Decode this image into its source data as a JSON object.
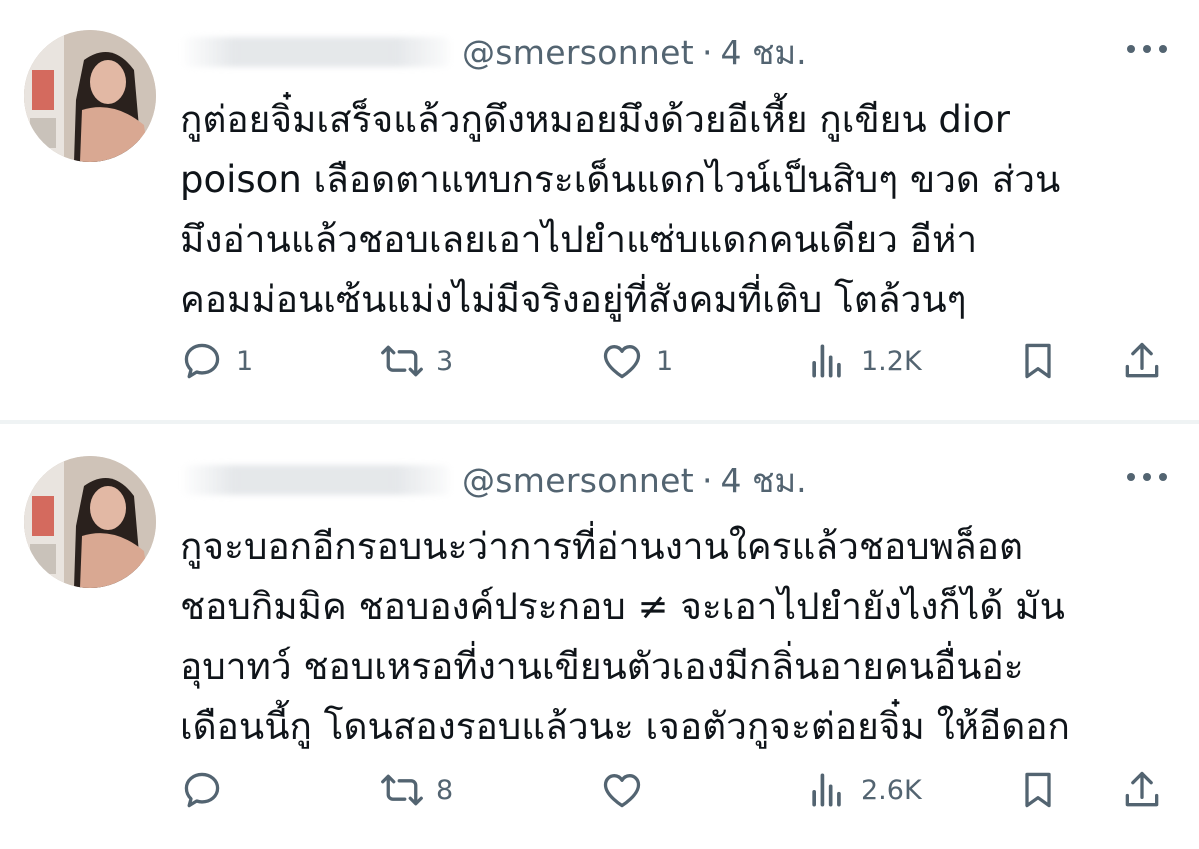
{
  "tweets": [
    {
      "handle": "@smersonnet",
      "separator": "·",
      "time": "4 ชม.",
      "text": "กูต่อยจิ๋มเสร็จแล้วกูดึงหมอยมึงด้วยอีเหี้ย กูเขียน dior\npoison เลือดตาแทบกระเด็นแดกไวน์เป็นสิบๆ ขวด ส่วน\nมึงอ่านแล้วชอบเลยเอาไปยำแซ่บแดกคนเดียว อีห่า\nคอมม่อนเซ้นแม่งไม่มีจริงอยู่ที่สังคมที่เติบ โตล้วนๆ",
      "replies": "1",
      "retweets": "3",
      "likes": "1",
      "views": "1.2K"
    },
    {
      "handle": "@smersonnet",
      "separator": "·",
      "time": "4 ชม.",
      "text": "กูจะบอกอีกรอบนะว่าการที่อ่านงานใครแล้วชอบพล็อต\nชอบกิมมิค ชอบองค์ประกอบ ≠ จะเอาไปยำยังไงก็ได้ มัน\nอุบาทว์ ชอบเหรอที่งานเขียนตัวเองมีกลิ่นอายคนอื่นอ่ะ\nเดือนนี้กู โดนสองรอบแล้วนะ เจอตัวกูจะต่อยจิ๋ม ให้อีดอก",
      "replies": "",
      "retweets": "8",
      "likes": "",
      "views": "2.6K"
    }
  ],
  "colors": {
    "text": "#0f1419",
    "secondary": "#536471",
    "divider": "#eff3f4"
  },
  "icons": [
    "reply-icon",
    "retweet-icon",
    "like-icon",
    "views-icon",
    "bookmark-icon",
    "share-icon",
    "more-icon"
  ]
}
